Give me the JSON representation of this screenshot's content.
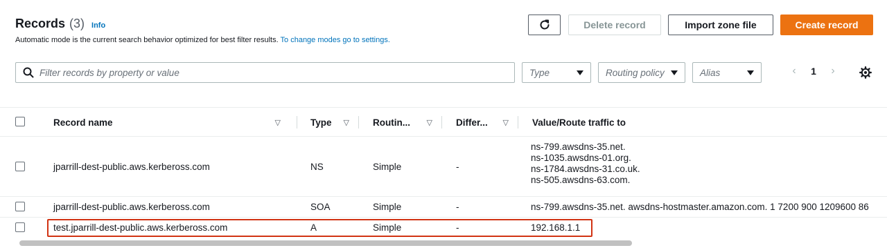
{
  "header": {
    "title": "Records",
    "count": "(3)",
    "info_link": "Info",
    "subtitle_text": "Automatic mode is the current search behavior optimized for best filter results. ",
    "subtitle_link": "To change modes go to settings."
  },
  "toolbar": {
    "refresh_icon": "refresh-icon",
    "delete_label": "Delete record",
    "import_label": "Import zone file",
    "create_label": "Create record"
  },
  "filters": {
    "search_placeholder": "Filter records by property or value",
    "type_placeholder": "Type",
    "routing_placeholder": "Routing policy",
    "alias_placeholder": "Alias"
  },
  "pagination": {
    "current_page": "1"
  },
  "table": {
    "columns": [
      {
        "label": "Record name"
      },
      {
        "label": "Type"
      },
      {
        "label": "Routin..."
      },
      {
        "label": "Differ..."
      },
      {
        "label": "Value/Route traffic to"
      }
    ],
    "rows": [
      {
        "name": "jparrill-dest-public.aws.kerbeross.com",
        "type": "NS",
        "routing": "Simple",
        "differ": "-",
        "values": [
          "ns-799.awsdns-35.net.",
          "ns-1035.awsdns-01.org.",
          "ns-1784.awsdns-31.co.uk.",
          "ns-505.awsdns-63.com."
        ]
      },
      {
        "name": "jparrill-dest-public.aws.kerbeross.com",
        "type": "SOA",
        "routing": "Simple",
        "differ": "-",
        "values": [
          "ns-799.awsdns-35.net. awsdns-hostmaster.amazon.com. 1 7200 900 1209600 86"
        ]
      },
      {
        "name": "test.jparrill-dest-public.aws.kerbeross.com",
        "type": "A",
        "routing": "Simple",
        "differ": "-",
        "values": [
          "192.168.1.1"
        ]
      }
    ]
  },
  "colors": {
    "primary_button": "#ec7211",
    "link": "#0073bb",
    "highlight_border": "#d13212"
  }
}
